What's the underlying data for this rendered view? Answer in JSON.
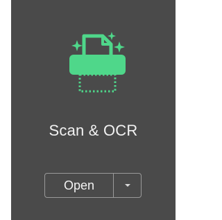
{
  "card": {
    "title": "Scan & OCR",
    "open_label": "Open",
    "icon": "scan-ocr-icon",
    "dropdown_icon": "caret-down-icon"
  },
  "colors": {
    "card_background": "#4a4a4a",
    "icon_accent": "#4fd78a",
    "text": "#f2f2f2",
    "button_border": "#9a9a9a"
  }
}
